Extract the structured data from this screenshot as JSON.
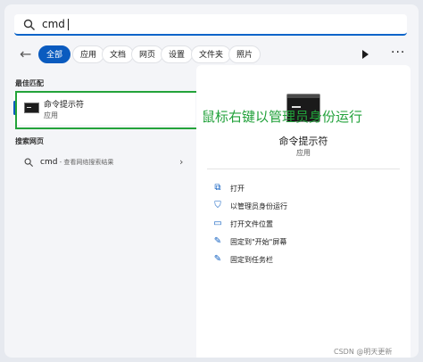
{
  "search": {
    "value": "cmd"
  },
  "filters": {
    "back_icon": "back-arrow-icon",
    "chips": [
      "全部",
      "应用",
      "文档",
      "网页",
      "设置",
      "文件夹",
      "照片"
    ],
    "active": "全部",
    "accent": "#0a5bbf"
  },
  "best_match": {
    "title": "最佳匹配",
    "item_title": "命令提示符",
    "item_sub": "应用"
  },
  "annotation": {
    "text": "鼠标右键以管理员身份运行",
    "color": "#21a13a"
  },
  "web": {
    "title": "搜索网页",
    "query": "cmd",
    "hint": " - 查看网络搜索结果"
  },
  "detail": {
    "title": "命令提示符",
    "subtitle": "应用",
    "actions": [
      {
        "label": "打开",
        "icon": "open-external-icon"
      },
      {
        "label": "以管理员身份运行",
        "icon": "shield-admin-icon"
      },
      {
        "label": "打开文件位置",
        "icon": "folder-icon"
      },
      {
        "label": "固定到\"开始\"屏幕",
        "icon": "pin-icon"
      },
      {
        "label": "固定到任务栏",
        "icon": "pin-icon"
      }
    ]
  },
  "watermark": "CSDN @明天更新"
}
